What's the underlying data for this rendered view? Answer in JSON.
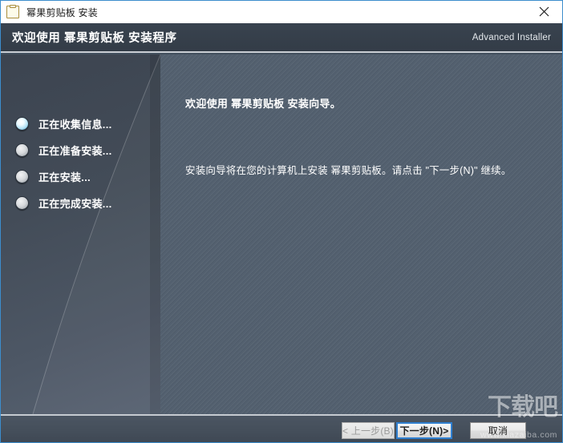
{
  "window": {
    "titlebar": {
      "icon": "clipboard-icon",
      "title": "幂果剪贴板 安装",
      "close_label": "✕"
    },
    "border_color": "#3c8dcd"
  },
  "header": {
    "title": "欢迎使用 幂果剪贴板 安装程序",
    "brand": "Advanced Installer",
    "background_color": "#39434f"
  },
  "sidebar": {
    "steps": [
      {
        "label": "正在收集信息...",
        "state": "active"
      },
      {
        "label": "正在准备安装...",
        "state": "pending"
      },
      {
        "label": "正在安装...",
        "state": "pending"
      },
      {
        "label": "正在完成安装...",
        "state": "pending"
      }
    ],
    "active_dot_color": "#b8e3f5",
    "pending_dot_color": "#d6d9dc"
  },
  "main": {
    "heading": "欢迎使用 幂果剪贴板 安装向导。",
    "body": "安装向导将在您的计算机上安装 幂果剪贴板。请点击 \"下一步(N)\" 继续。",
    "background_color": "#53606f"
  },
  "footer": {
    "back_button": "< 上一步(B)",
    "next_button": "下一步(N)>",
    "cancel_button": "取消",
    "back_disabled": true,
    "next_focused": true,
    "focus_color": "#2f7fd0"
  },
  "watermark": {
    "logo": "下载吧",
    "url": "www.xiazaiba.com"
  }
}
